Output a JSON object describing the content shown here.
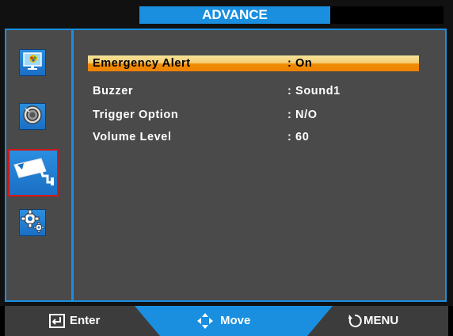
{
  "title": "ADVANCE",
  "menu": {
    "rows": [
      {
        "label": "Emergency Alert",
        "value": ": On"
      },
      {
        "label": "Buzzer",
        "value": ": Sound1"
      },
      {
        "label": "Trigger Option",
        "value": ": N/O"
      },
      {
        "label": "Volume Level",
        "value": ": 60"
      }
    ]
  },
  "sidebar": {
    "icons": [
      "display-settings-icon",
      "speaker-icon",
      "security-camera-icon",
      "gear-settings-icon"
    ]
  },
  "footer": {
    "enter_label": "Enter",
    "move_label": "Move",
    "menu_label": "MENU"
  },
  "colors": {
    "accent": "#1a8fe0",
    "highlight_top": "#f7e29a",
    "highlight_bottom": "#ef8200",
    "selected_border": "#d01818"
  }
}
